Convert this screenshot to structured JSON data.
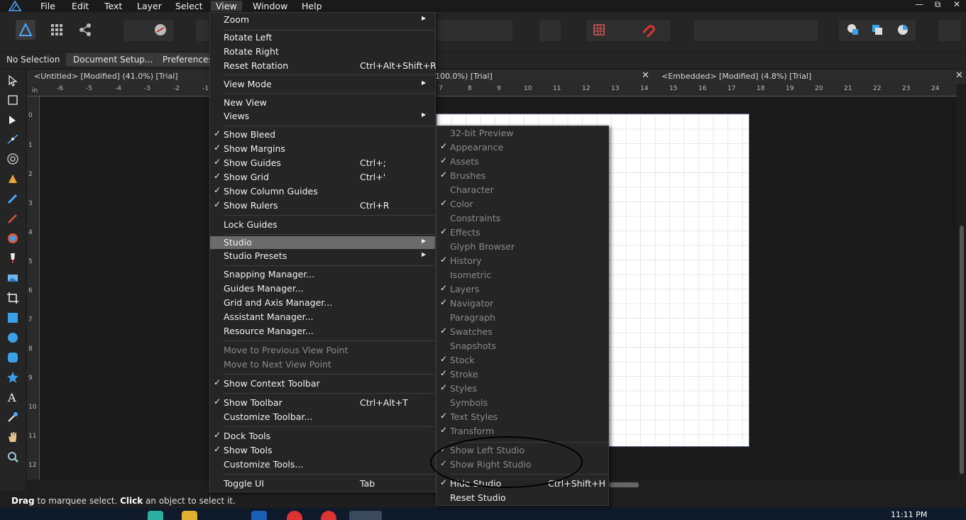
{
  "menubar": {
    "items": [
      "File",
      "Edit",
      "Text",
      "Layer",
      "Select",
      "View",
      "Window",
      "Help"
    ]
  },
  "window_controls": [
    "—",
    "⧉",
    "✕"
  ],
  "context": {
    "selection": "No Selection",
    "document_setup": "Document Setup...",
    "preferences": "Preferences..."
  },
  "doc_tabs": {
    "tab1": "<Untitled> [Modified] (41.0%) [Trial]",
    "tab2": "100.0%) [Trial]",
    "tab3": "<Embedded> [Modified] (4.8%) [Trial]"
  },
  "ruler": {
    "unit": "in",
    "h_numbers": [
      "-6",
      "-5",
      "-4",
      "-3",
      "-2",
      "-1",
      "7",
      "8",
      "9",
      "10",
      "11",
      "12",
      "13",
      "14",
      "15",
      "16",
      "17",
      "18",
      "19",
      "20",
      "21",
      "22",
      "23",
      "24"
    ],
    "v_numbers": [
      "0",
      "1",
      "2",
      "3",
      "4",
      "5",
      "6",
      "7",
      "8",
      "9",
      "10",
      "11",
      "12"
    ]
  },
  "view_menu": {
    "zoom": "Zoom",
    "rotate_left": "Rotate Left",
    "rotate_right": "Rotate Right",
    "reset_rotation": "Reset Rotation",
    "reset_rotation_sc": "Ctrl+Alt+Shift+R",
    "view_mode": "View Mode",
    "new_view": "New View",
    "views": "Views",
    "show_bleed": "Show Bleed",
    "show_margins": "Show Margins",
    "show_guides": "Show Guides",
    "show_guides_sc": "Ctrl+;",
    "show_grid": "Show Grid",
    "show_grid_sc": "Ctrl+'",
    "show_column_guides": "Show Column Guides",
    "show_rulers": "Show Rulers",
    "show_rulers_sc": "Ctrl+R",
    "lock_guides": "Lock Guides",
    "studio": "Studio",
    "studio_presets": "Studio Presets",
    "snapping_manager": "Snapping Manager...",
    "guides_manager": "Guides Manager...",
    "grid_axis_manager": "Grid and Axis Manager...",
    "assistant_manager": "Assistant Manager...",
    "resource_manager": "Resource Manager...",
    "move_prev": "Move to Previous View Point",
    "move_next": "Move to Next View Point",
    "show_context_toolbar": "Show Context Toolbar",
    "show_toolbar": "Show Toolbar",
    "show_toolbar_sc": "Ctrl+Alt+T",
    "customize_toolbar": "Customize Toolbar...",
    "dock_tools": "Dock Tools",
    "show_tools": "Show Tools",
    "customize_tools": "Customize Tools...",
    "toggle_ui": "Toggle UI",
    "toggle_ui_sc": "Tab"
  },
  "studio_menu": {
    "items": [
      {
        "label": "32-bit Preview",
        "checked": false
      },
      {
        "label": "Appearance",
        "checked": true
      },
      {
        "label": "Assets",
        "checked": true
      },
      {
        "label": "Brushes",
        "checked": true
      },
      {
        "label": "Character",
        "checked": false
      },
      {
        "label": "Color",
        "checked": true
      },
      {
        "label": "Constraints",
        "checked": false
      },
      {
        "label": "Effects",
        "checked": true
      },
      {
        "label": "Glyph Browser",
        "checked": false
      },
      {
        "label": "History",
        "checked": true
      },
      {
        "label": "Isometric",
        "checked": false
      },
      {
        "label": "Layers",
        "checked": true
      },
      {
        "label": "Navigator",
        "checked": true
      },
      {
        "label": "Paragraph",
        "checked": false
      },
      {
        "label": "Swatches",
        "checked": true
      },
      {
        "label": "Snapshots",
        "checked": false
      },
      {
        "label": "Stock",
        "checked": true
      },
      {
        "label": "Stroke",
        "checked": true
      },
      {
        "label": "Styles",
        "checked": true
      },
      {
        "label": "Symbols",
        "checked": false
      },
      {
        "label": "Text Styles",
        "checked": true
      },
      {
        "label": "Transform",
        "checked": true
      }
    ],
    "show_left_studio": "Show Left Studio",
    "show_right_studio": "Show Right Studio",
    "hide_studio": "Hide Studio",
    "hide_studio_sc": "Ctrl+Shift+H",
    "reset_studio": "Reset Studio"
  },
  "check_glyph": "✓",
  "submenu_glyph": "▶",
  "status": {
    "drag": "Drag",
    "text1": " to marquee select. ",
    "click": "Click",
    "text2": " an object to select it."
  },
  "taskbar": {
    "clock": "11:11 PM"
  },
  "colors": {
    "accent": "#3aa0e8",
    "menu_bg": "#252525",
    "highlight": "#6b6b6b"
  }
}
